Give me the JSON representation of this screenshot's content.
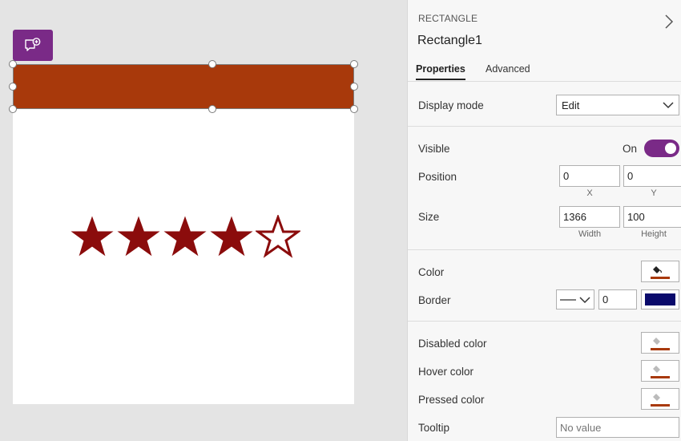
{
  "panel": {
    "control_type": "RECTANGLE",
    "control_name": "Rectangle1",
    "tabs": [
      {
        "label": "Properties",
        "active": true
      },
      {
        "label": "Advanced",
        "active": false
      }
    ],
    "display_mode": {
      "label": "Display mode",
      "value": "Edit"
    },
    "visible": {
      "label": "Visible",
      "state_text": "On",
      "on": true
    },
    "position": {
      "label": "Position",
      "x": "0",
      "y": "0",
      "x_label": "X",
      "y_label": "Y"
    },
    "size": {
      "label": "Size",
      "width": "1366",
      "height": "100",
      "width_label": "Width",
      "height_label": "Height"
    },
    "color": {
      "label": "Color",
      "value": "#a8390b"
    },
    "border": {
      "label": "Border",
      "thickness": "0",
      "color": "#0a0a6b"
    },
    "disabled_color": {
      "label": "Disabled color"
    },
    "hover_color": {
      "label": "Hover color"
    },
    "pressed_color": {
      "label": "Pressed color"
    },
    "tooltip": {
      "label": "Tooltip",
      "placeholder": "No value"
    }
  },
  "canvas": {
    "rectangle_fill": "#a8390b",
    "rating": {
      "value": 4,
      "max": 5,
      "color": "#8b0c0c"
    }
  }
}
